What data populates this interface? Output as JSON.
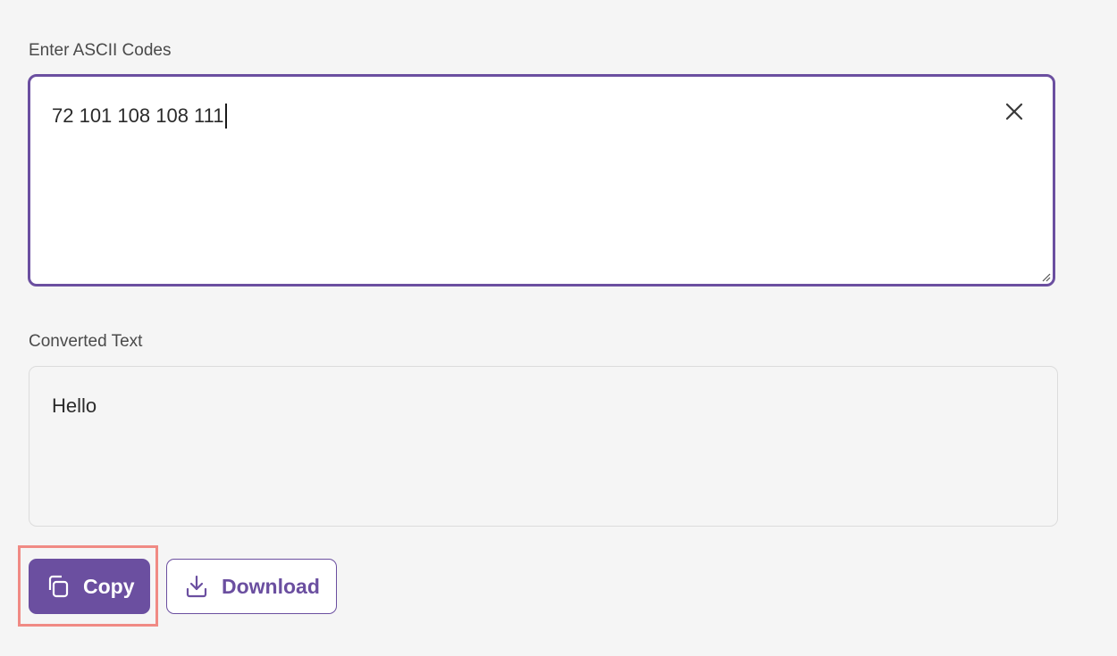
{
  "input": {
    "label": "Enter ASCII Codes",
    "value": "72 101 108 108 111"
  },
  "output": {
    "label": "Converted Text",
    "value": "Hello"
  },
  "actions": {
    "copy_label": "Copy",
    "download_label": "Download"
  },
  "icons": {
    "clear": "close-icon",
    "copy": "copy-icon",
    "download": "download-icon"
  },
  "colors": {
    "accent": "#6b4fa0",
    "highlight": "#f08a84",
    "background": "#f5f5f5"
  }
}
